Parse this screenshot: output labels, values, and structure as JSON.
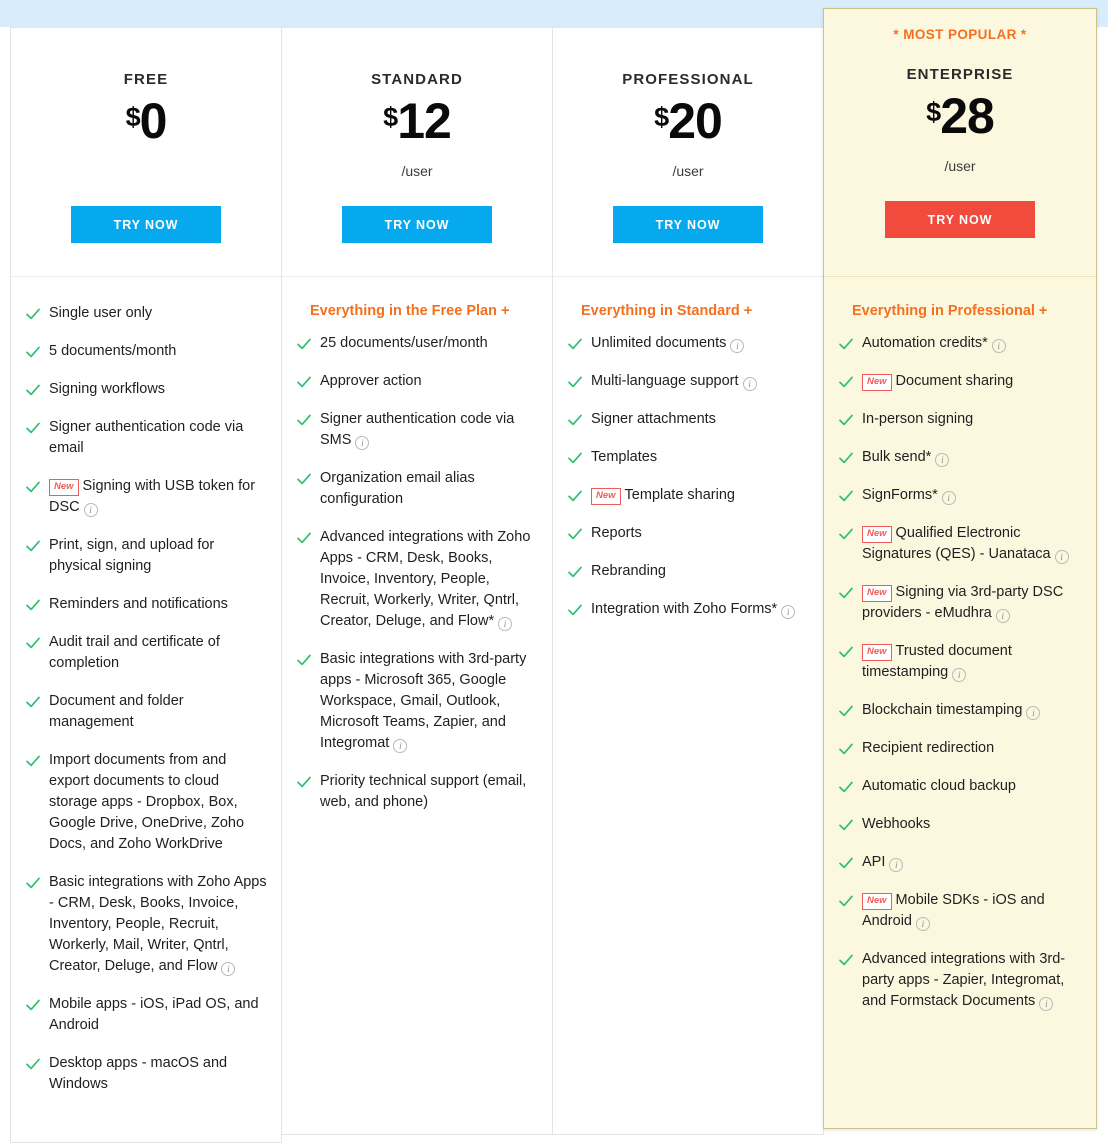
{
  "theme": {
    "top_banner_color": "#d9ecfb",
    "cta_blue": "#07a9ee",
    "cta_red": "#f04b3c",
    "accent_orange": "#f4701f",
    "check_green": "#2fbf71",
    "featured_bg": "#fcf8df",
    "featured_border": "#c9c389",
    "new_badge_color": "#ef5c5c"
  },
  "labels": {
    "new_badge": "New",
    "info_icon": "i",
    "check_icon": "check-icon"
  },
  "plans": [
    {
      "id": "free",
      "name": "FREE",
      "currency": "$",
      "amount": "0",
      "per": "",
      "cta": "TRY NOW",
      "cta_style": "blue",
      "popular": "",
      "featured": false,
      "features_title": "",
      "features": [
        {
          "text": "Single user only"
        },
        {
          "text": "5 documents/month"
        },
        {
          "text": "Signing workflows"
        },
        {
          "text": "Signer authentication code via email"
        },
        {
          "badge": "New",
          "text": "Signing with USB token for DSC",
          "info": true
        },
        {
          "text": "Print, sign, and upload for physical signing"
        },
        {
          "text": "Reminders and notifications"
        },
        {
          "text": "Audit trail and certificate of completion"
        },
        {
          "text": "Document and folder management"
        },
        {
          "text": "Import documents from and export documents to cloud storage apps - Dropbox, Box, Google Drive, OneDrive, Zoho Docs, and Zoho WorkDrive"
        },
        {
          "text": "Basic integrations with Zoho Apps - CRM, Desk, Books, Invoice, Inventory, People, Recruit, Workerly, Mail, Writer, Qntrl, Creator, Deluge, and Flow",
          "info": true
        },
        {
          "text": "Mobile apps - iOS, iPad OS, and Android"
        },
        {
          "text": "Desktop apps - macOS and Windows"
        }
      ]
    },
    {
      "id": "standard",
      "name": "STANDARD",
      "currency": "$",
      "amount": "12",
      "per": "/user",
      "cta": "TRY NOW",
      "cta_style": "blue",
      "popular": "",
      "featured": false,
      "features_title": "Everything in the Free Plan +",
      "features": [
        {
          "text": "25 documents/user/month"
        },
        {
          "text": "Approver action"
        },
        {
          "text": "Signer authentication code via SMS",
          "info": true
        },
        {
          "text": "Organization email alias configuration"
        },
        {
          "text": "Advanced integrations with Zoho Apps - CRM, Desk, Books, Invoice, Inventory, People, Recruit, Workerly, Writer, Qntrl, Creator, Deluge, and Flow*",
          "info": true
        },
        {
          "text": "Basic integrations with 3rd-party apps - Microsoft 365, Google Workspace, Gmail, Outlook, Microsoft Teams, Zapier, and Integromat",
          "info": true
        },
        {
          "text": "Priority technical support (email, web, and phone)"
        }
      ]
    },
    {
      "id": "professional",
      "name": "PROFESSIONAL",
      "currency": "$",
      "amount": "20",
      "per": "/user",
      "cta": "TRY NOW",
      "cta_style": "blue",
      "popular": "",
      "featured": false,
      "features_title": "Everything in Standard +",
      "features": [
        {
          "text": "Unlimited documents",
          "info": true
        },
        {
          "text": "Multi-language support",
          "info": true
        },
        {
          "text": "Signer attachments"
        },
        {
          "text": "Templates"
        },
        {
          "badge": "New",
          "text": "Template sharing"
        },
        {
          "text": "Reports"
        },
        {
          "text": "Rebranding"
        },
        {
          "text": "Integration with Zoho Forms*",
          "info": true
        }
      ]
    },
    {
      "id": "enterprise",
      "name": "ENTERPRISE",
      "currency": "$",
      "amount": "28",
      "per": "/user",
      "cta": "TRY NOW",
      "cta_style": "red",
      "popular": "* MOST POPULAR *",
      "featured": true,
      "features_title": "Everything in Professional +",
      "features": [
        {
          "text": "Automation credits*",
          "info": true
        },
        {
          "badge": "New",
          "text": "Document sharing"
        },
        {
          "text": "In-person signing"
        },
        {
          "text": "Bulk send*",
          "info": true
        },
        {
          "text": "SignForms*",
          "info": true
        },
        {
          "badge": "New",
          "text": "Qualified Electronic Signatures (QES) - Uanataca",
          "info": true
        },
        {
          "badge": "New",
          "text": "Signing via 3rd-party DSC providers - eMudhra",
          "info": true
        },
        {
          "badge": "New",
          "text": "Trusted document timestamping",
          "info": true
        },
        {
          "text": "Blockchain timestamping",
          "info": true
        },
        {
          "text": "Recipient redirection"
        },
        {
          "text": "Automatic cloud backup"
        },
        {
          "text": "Webhooks"
        },
        {
          "text": "API",
          "info": true
        },
        {
          "badge": "New",
          "text": "Mobile SDKs - iOS and Android",
          "info": true
        },
        {
          "text": "Advanced integrations with 3rd-party apps - Zapier, Integromat, and Formstack Documents",
          "info": true
        }
      ]
    }
  ]
}
